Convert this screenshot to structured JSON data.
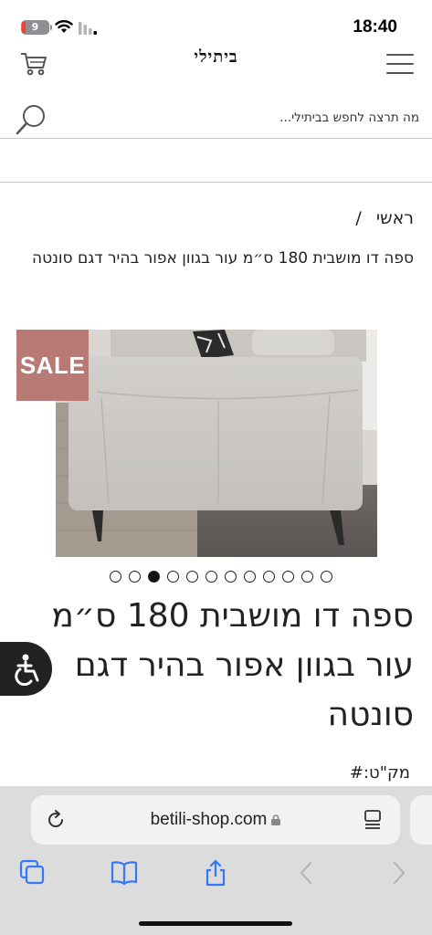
{
  "status_bar": {
    "time": "18:40",
    "battery_level": "9",
    "icons": [
      "battery-icon",
      "wifi-icon",
      "cellular-signal-icon"
    ]
  },
  "header": {
    "logo_text": "ביתילי",
    "icons": [
      "cart-icon",
      "hamburger-menu-icon"
    ]
  },
  "search": {
    "placeholder": "מה תרצה לחפש בביתילי..."
  },
  "breadcrumb": {
    "home": "ראשי",
    "separator": "/",
    "current": "ספה דו מושבית 180 ס״מ עור בגוון אפור בהיר דגם סונטה"
  },
  "product": {
    "sale_badge": "SALE",
    "title_lines": [
      "ספה דו מושבית 180 ס״מ",
      "עור בגוון אפור בהיר דגם",
      "סונטה"
    ],
    "sku_label": "מק\"ט:#",
    "image_description": "light grey leather sofa, rear view",
    "carousel": {
      "total_slides": 12,
      "active_index": 2
    }
  },
  "browser": {
    "url": "betili-shop.com",
    "toolbar": [
      "tabs-icon",
      "bookmarks-icon",
      "share-icon",
      "back-icon",
      "forward-icon"
    ]
  },
  "colors": {
    "sale_badge": "#b77a74",
    "accessibility_bg": "#222222",
    "browser_bar": "#dcdcdc",
    "toolbar_active": "#3478f6",
    "toolbar_disabled": "#b5b5b5"
  }
}
